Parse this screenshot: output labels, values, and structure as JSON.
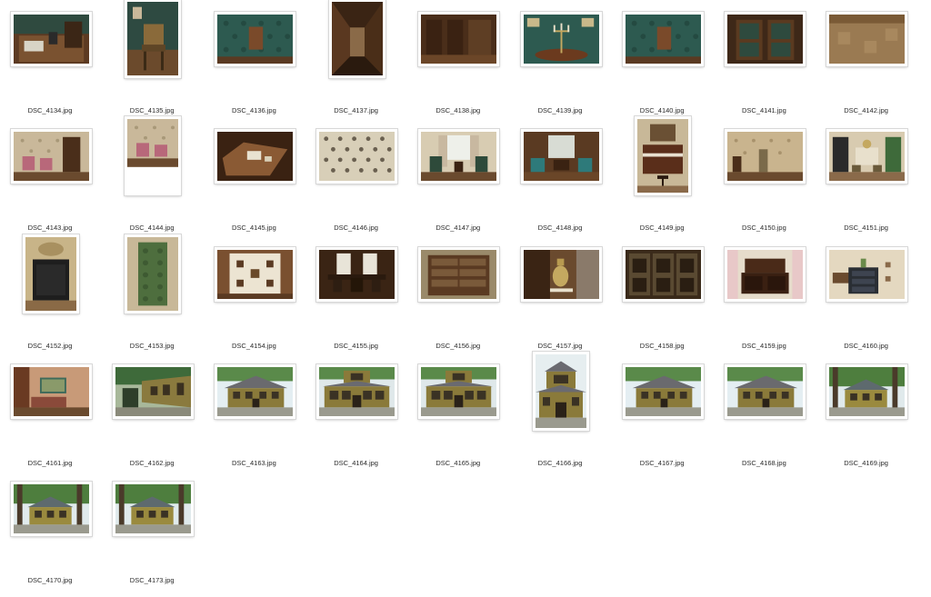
{
  "files": [
    {
      "name": "DSC_4134.jpg",
      "orientation": "landscape",
      "scene": "desk"
    },
    {
      "name": "DSC_4135.jpg",
      "orientation": "portrait",
      "scene": "chair"
    },
    {
      "name": "DSC_4136.jpg",
      "orientation": "landscape",
      "scene": "green-wall"
    },
    {
      "name": "DSC_4137.jpg",
      "orientation": "portrait",
      "scene": "corridor"
    },
    {
      "name": "DSC_4138.jpg",
      "orientation": "landscape",
      "scene": "paneled-room"
    },
    {
      "name": "DSC_4139.jpg",
      "orientation": "landscape",
      "scene": "candelabra"
    },
    {
      "name": "DSC_4140.jpg",
      "orientation": "landscape",
      "scene": "green-wall"
    },
    {
      "name": "DSC_4141.jpg",
      "orientation": "landscape",
      "scene": "cabinet"
    },
    {
      "name": "DSC_4142.jpg",
      "orientation": "landscape",
      "scene": "floor"
    },
    {
      "name": "DSC_4143.jpg",
      "orientation": "landscape",
      "scene": "pink-chairs"
    },
    {
      "name": "DSC_4144.jpg",
      "orientation": "portrait",
      "scene": "pink-chairs"
    },
    {
      "name": "DSC_4145.jpg",
      "orientation": "landscape",
      "scene": "table-top"
    },
    {
      "name": "DSC_4146.jpg",
      "orientation": "landscape",
      "scene": "wallpaper"
    },
    {
      "name": "DSC_4147.jpg",
      "orientation": "landscape",
      "scene": "window-chairs"
    },
    {
      "name": "DSC_4148.jpg",
      "orientation": "landscape",
      "scene": "teal-chairs"
    },
    {
      "name": "DSC_4149.jpg",
      "orientation": "portrait",
      "scene": "piano"
    },
    {
      "name": "DSC_4150.jpg",
      "orientation": "landscape",
      "scene": "beige-wall"
    },
    {
      "name": "DSC_4151.jpg",
      "orientation": "landscape",
      "scene": "fireplace"
    },
    {
      "name": "DSC_4152.jpg",
      "orientation": "portrait",
      "scene": "black-cabinet"
    },
    {
      "name": "DSC_4153.jpg",
      "orientation": "portrait",
      "scene": "tile-stove"
    },
    {
      "name": "DSC_4154.jpg",
      "orientation": "landscape",
      "scene": "cream-panel"
    },
    {
      "name": "DSC_4155.jpg",
      "orientation": "landscape",
      "scene": "dark-dining"
    },
    {
      "name": "DSC_4156.jpg",
      "orientation": "landscape",
      "scene": "drawers"
    },
    {
      "name": "DSC_4157.jpg",
      "orientation": "landscape",
      "scene": "samovar"
    },
    {
      "name": "DSC_4158.jpg",
      "orientation": "landscape",
      "scene": "carved-panels"
    },
    {
      "name": "DSC_4159.jpg",
      "orientation": "landscape",
      "scene": "sideboard"
    },
    {
      "name": "DSC_4160.jpg",
      "orientation": "landscape",
      "scene": "dresser"
    },
    {
      "name": "DSC_4161.jpg",
      "orientation": "landscape",
      "scene": "picture-room"
    },
    {
      "name": "DSC_4162.jpg",
      "orientation": "landscape",
      "scene": "house-side"
    },
    {
      "name": "DSC_4163.jpg",
      "orientation": "landscape",
      "scene": "house"
    },
    {
      "name": "DSC_4164.jpg",
      "orientation": "landscape",
      "scene": "house-front"
    },
    {
      "name": "DSC_4165.jpg",
      "orientation": "landscape",
      "scene": "house-front"
    },
    {
      "name": "DSC_4166.jpg",
      "orientation": "portrait",
      "scene": "house-portrait"
    },
    {
      "name": "DSC_4167.jpg",
      "orientation": "landscape",
      "scene": "house"
    },
    {
      "name": "DSC_4168.jpg",
      "orientation": "landscape",
      "scene": "house"
    },
    {
      "name": "DSC_4169.jpg",
      "orientation": "landscape",
      "scene": "house-trees"
    },
    {
      "name": "DSC_4170.jpg",
      "orientation": "landscape",
      "scene": "house-trees"
    },
    {
      "name": "DSC_4173.jpg",
      "orientation": "landscape",
      "scene": "house-trees"
    }
  ]
}
